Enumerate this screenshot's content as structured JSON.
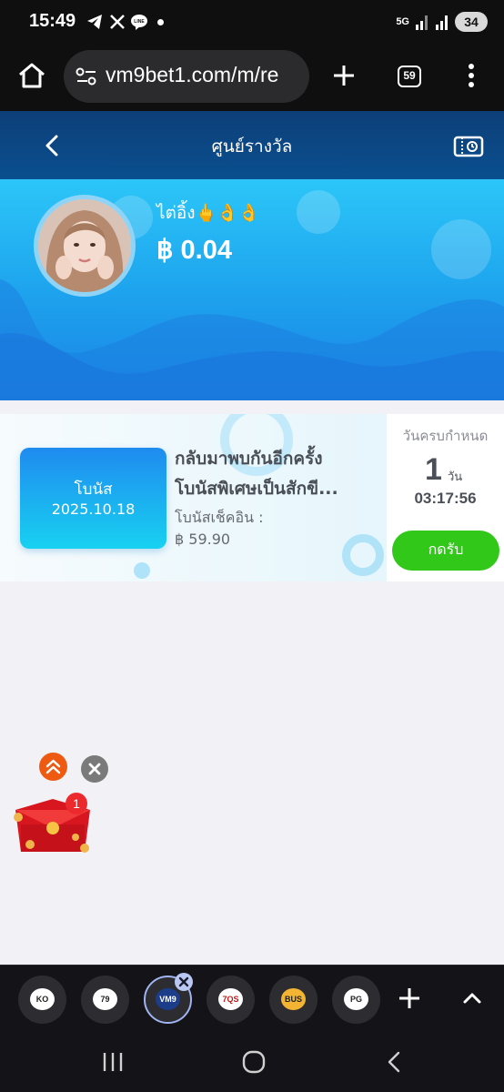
{
  "status_bar": {
    "time": "15:49",
    "network": "5G",
    "battery": "34"
  },
  "browser": {
    "url": "vm9bet1.com/m/re",
    "tab_count": "59"
  },
  "page": {
    "title": "ศูนย์รางวัล"
  },
  "profile": {
    "username": "ไต่อิ้ง🖕👌👌",
    "balance": "฿ 0.04"
  },
  "bonus_card": {
    "tile_label": "โบนัส",
    "tile_date": "2025.10.18",
    "title_line1": "กลับมาพบกันอีกครั้ง",
    "title_line2": "โบนัสพิเศษเป็นสักขี...",
    "checkin_label": "โบนัสเช็คอิน :",
    "amount": "฿ 59.90",
    "due_label": "วันครบกำหนด",
    "days": "1",
    "days_unit": "วัน",
    "countdown": "03:17:56",
    "claim_label": "กดรับ"
  },
  "widgets": {
    "red_packet_count": "1"
  },
  "tabs": [
    {
      "label": "KO"
    },
    {
      "label": "79"
    },
    {
      "label": "VM9"
    },
    {
      "label": "7QS"
    },
    {
      "label": "BUS"
    },
    {
      "label": "PG"
    }
  ],
  "colors": {
    "header": "#0d3f78",
    "hero": "#1ea4ee",
    "claim": "#32c81a"
  }
}
